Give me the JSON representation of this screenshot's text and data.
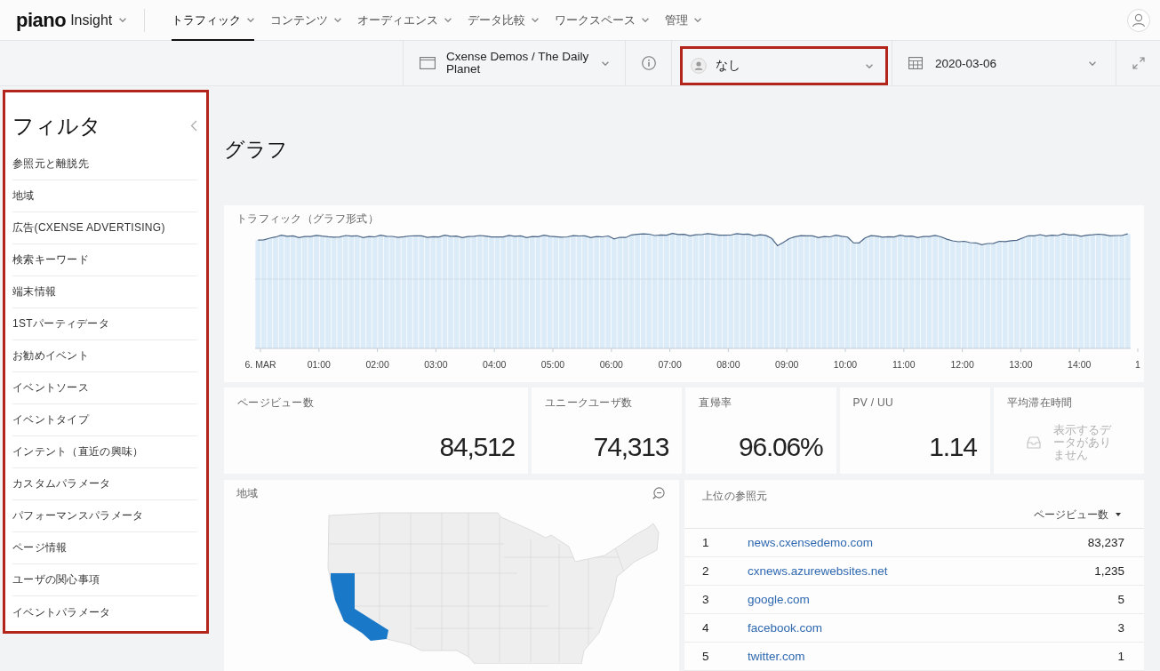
{
  "header": {
    "logo": "piano",
    "product": "Insight",
    "nav": [
      {
        "label": "トラフィック",
        "selected": true
      },
      {
        "label": "コンテンツ",
        "selected": false
      },
      {
        "label": "オーディエンス",
        "selected": false
      },
      {
        "label": "データ比較",
        "selected": false
      },
      {
        "label": "ワークスペース",
        "selected": false
      },
      {
        "label": "管理",
        "selected": false
      }
    ]
  },
  "toolbar": {
    "site": "Cxense Demos / The Daily Planet",
    "segment": {
      "value": "なし",
      "highlighted": true
    },
    "date": "2020-03-06"
  },
  "filters": {
    "title": "フィルタ",
    "highlighted": true,
    "items": [
      "参照元と離脱先",
      "地域",
      "広告(CXENSE ADVERTISING)",
      "検索キーワード",
      "端末情報",
      "1STパーティデータ",
      "お勧めイベント",
      "イベントソース",
      "イベントタイプ",
      "インテント（直近の興味）",
      "カスタムパラメータ",
      "パフォーマンスパラメータ",
      "ページ情報",
      "ユーザの関心事項",
      "イベントパラメータ"
    ]
  },
  "page_title": "グラフ",
  "traffic_chart": {
    "title": "トラフィック（グラフ形式）",
    "x_labels": [
      "6. MAR",
      "01:00",
      "02:00",
      "03:00",
      "04:00",
      "05:00",
      "06:00",
      "07:00",
      "08:00",
      "09:00",
      "10:00",
      "11:00",
      "12:00",
      "13:00",
      "14:00",
      "1"
    ]
  },
  "metrics": [
    {
      "kind": "number",
      "label": "ページビュー数",
      "value": "84,512"
    },
    {
      "kind": "number",
      "label": "ユニークユーザ数",
      "value": "74,313"
    },
    {
      "kind": "number",
      "label": "直帰率",
      "value": "96.06%"
    },
    {
      "kind": "number",
      "label": "PV / UU",
      "value": "1.14"
    },
    {
      "kind": "empty",
      "label": "平均滞在時間",
      "message": "表示するデータがありません"
    }
  ],
  "region_map": {
    "title": "地域"
  },
  "top_referrers": {
    "title": "上位の参照元",
    "sort_column": "ページビュー数",
    "rows": [
      {
        "rank": "1",
        "source": "news.cxensedemo.com",
        "pageviews": "83,237"
      },
      {
        "rank": "2",
        "source": "cxnews.azurewebsites.net",
        "pageviews": "1,235"
      },
      {
        "rank": "3",
        "source": "google.com",
        "pageviews": "5"
      },
      {
        "rank": "4",
        "source": "facebook.com",
        "pageviews": "3"
      },
      {
        "rank": "5",
        "source": "twitter.com",
        "pageviews": "1"
      }
    ]
  }
}
